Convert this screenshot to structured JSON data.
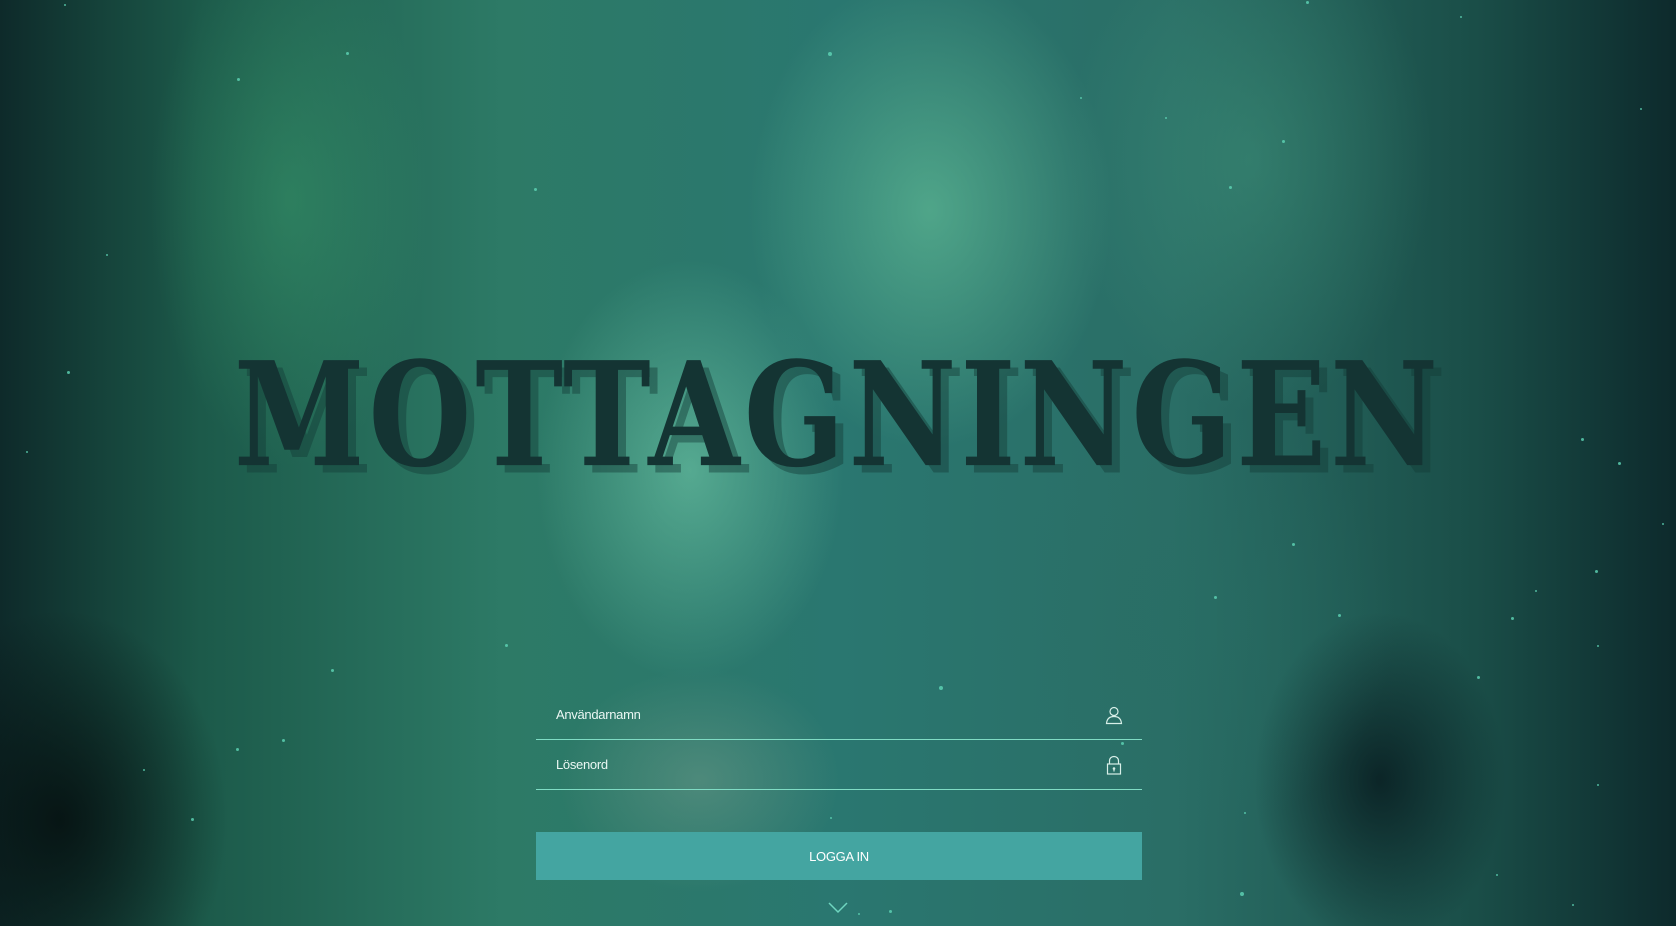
{
  "page": {
    "title": "MOTTAGNINGEN"
  },
  "login": {
    "username_placeholder": "Användarnamn",
    "password_placeholder": "Lösenord",
    "submit_label": "LOGGA IN"
  },
  "icons": {
    "username": "user-icon",
    "password": "lock-icon",
    "scroll": "chevron-down-icon"
  },
  "colors": {
    "accent": "#44a5a1",
    "field_underline": "#7fdcc4",
    "title": "#143433"
  }
}
